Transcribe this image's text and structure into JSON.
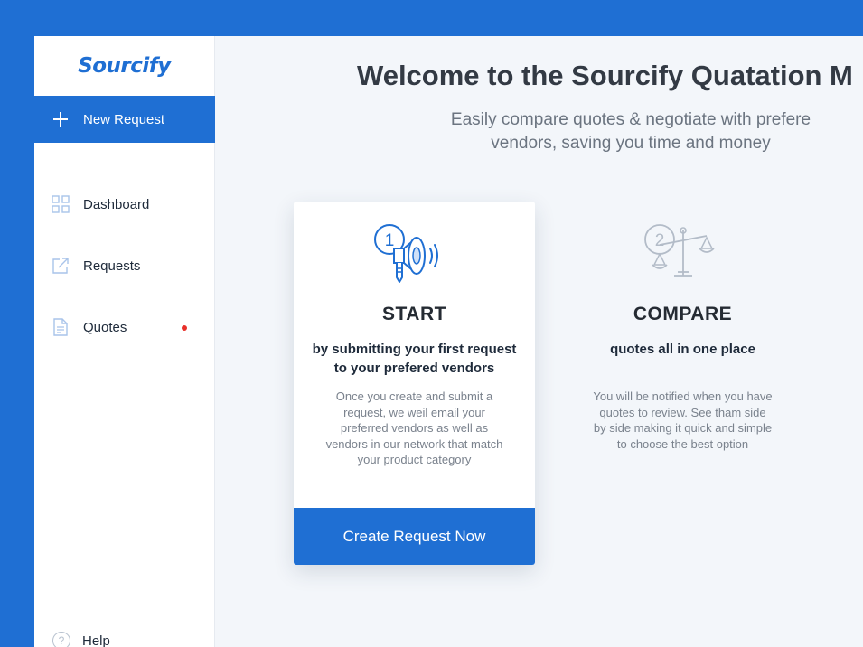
{
  "brand": {
    "logo": "Sourcify",
    "color": "#1f6fd3"
  },
  "sidebar": {
    "new_request": "New Request",
    "items": [
      {
        "label": "Dashboard",
        "icon": "grid-icon"
      },
      {
        "label": "Requests",
        "icon": "external-link-icon"
      },
      {
        "label": "Quotes",
        "icon": "document-icon",
        "badge": "notification-dot"
      }
    ],
    "help": "Help"
  },
  "main": {
    "title": "Welcome to the Sourcify Quatation M",
    "subtitle_line1": "Easily compare quotes & negotiate with prefere",
    "subtitle_line2": "vendors, saving you time and money",
    "steps": [
      {
        "number": "1",
        "icon": "megaphone-icon",
        "title": "START",
        "subtitle_line1": "by submitting your first request",
        "subtitle_line2": "to your prefered vendors",
        "desc_lines": [
          "Once you create and submit a",
          "request, we weil email your",
          "preferred vendors as well as",
          "vendors in our network that match",
          "your product category"
        ],
        "button": "Create Request Now"
      },
      {
        "number": "2",
        "icon": "scale-icon",
        "title": "COMPARE",
        "subtitle": "quotes all in one place",
        "desc_lines": [
          "You will be notified when you have",
          "quotes to review. See tham side",
          "by side making it quick and simple",
          "to choose the best option"
        ]
      }
    ]
  }
}
